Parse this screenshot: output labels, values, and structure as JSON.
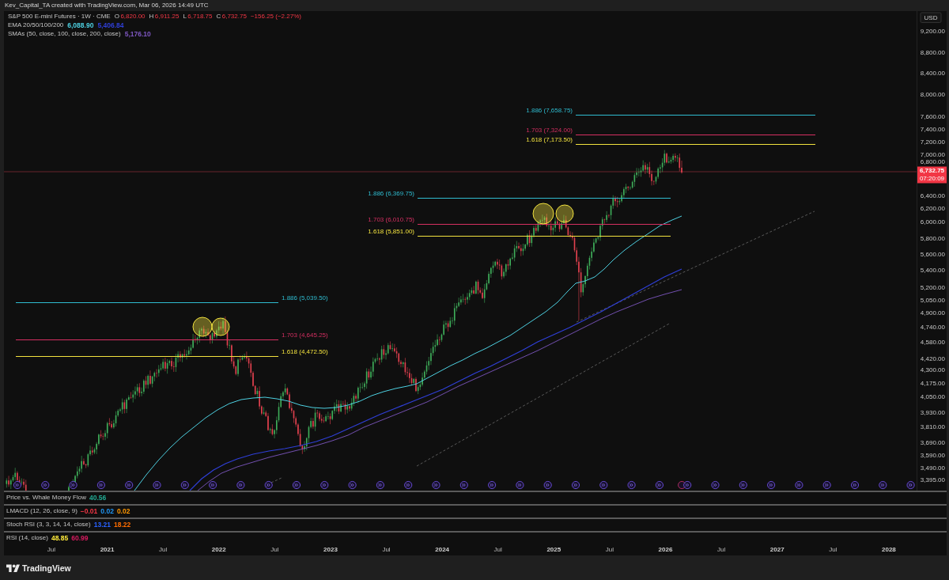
{
  "credit": "Kev_Capital_TA created with TradingView.com, Mar 06, 2026 14:49 UTC",
  "symbol": {
    "name": "S&P 500 E-mini Futures · 1W · CME",
    "down": true,
    "ohlc": [
      {
        "key": "O",
        "value": "6,820.00"
      },
      {
        "key": "H",
        "value": "6,911.25"
      },
      {
        "key": "L",
        "value": "6,718.75"
      },
      {
        "key": "C",
        "value": "6,732.75"
      }
    ],
    "change": "−156.25 (−2.27%)"
  },
  "studies": [
    {
      "name": "EMA 20/50/100/200",
      "values": [
        {
          "text": "6,088.90",
          "color": "#4dd0e1"
        },
        {
          "text": "5,406.84",
          "color": "#2f3fd8"
        }
      ]
    },
    {
      "name": "SMAs (50, close, 100, close, 200, close)",
      "values": [
        {
          "text": "5,176.10",
          "color": "#7e57c2"
        }
      ]
    }
  ],
  "fib_extensions": [
    {
      "levels": [
        {
          "label": "1.886 (5,039.50)",
          "color": "#2fbcd0"
        },
        {
          "label": "1.703 (4,645.25)",
          "color": "#d62f62"
        },
        {
          "label": "1.618 (4,472.50)",
          "color": "#f2e23f"
        }
      ]
    },
    {
      "levels": [
        {
          "label": "1.886 (6,369.75)",
          "color": "#2fbcd0"
        },
        {
          "label": "1.703 (6,010.75)",
          "color": "#d62f62"
        },
        {
          "label": "1.618 (5,851.00)",
          "color": "#f2e23f"
        }
      ]
    },
    {
      "levels": [
        {
          "label": "1.886 (7,658.75)",
          "color": "#2fbcd0"
        },
        {
          "label": "1.703 (7,324.00)",
          "color": "#d62f62"
        },
        {
          "label": "1.618 (7,173.50)",
          "color": "#f2e23f"
        }
      ]
    }
  ],
  "last_price": {
    "price": "6,732.75",
    "countdown": "07:20:09"
  },
  "price_axis": {
    "currency": "USD",
    "labels": [
      "9,200.00",
      "8,800.00",
      "8,400.00",
      "8,000.00",
      "7,600.00",
      "7,400.00",
      "7,200.00",
      "7,000.00",
      "6,800.00",
      "6,400.00",
      "6,200.00",
      "6,000.00",
      "5,800.00",
      "5,600.00",
      "5,400.00",
      "5,200.00",
      "5,050.00",
      "4,900.00",
      "4,740.00",
      "4,580.00",
      "4,420.00",
      "4,300.00",
      "4,175.00",
      "4,050.00",
      "3,930.00",
      "3,810.00",
      "3,690.00",
      "3,590.00",
      "3,490.00",
      "3,395.00"
    ]
  },
  "panes": [
    {
      "name": "Price vs. Whale Money Flow",
      "values": [
        {
          "text": "40.56",
          "color": "#22ab94"
        }
      ]
    },
    {
      "name": "LMACD (12, 26, close, 9)",
      "values": [
        {
          "text": "−0.01",
          "color": "#f23645"
        },
        {
          "text": "0.02",
          "color": "#2196f3"
        },
        {
          "text": "0.02",
          "color": "#ff9800"
        }
      ]
    },
    {
      "name": "Stoch RSI (3, 3, 14, 14, close)",
      "values": [
        {
          "text": "13.21",
          "color": "#2962ff"
        },
        {
          "text": "18.22",
          "color": "#ff6d00"
        }
      ]
    },
    {
      "name": "RSI (14, close)",
      "values": [
        {
          "text": "48.85",
          "color": "#ffeb3b"
        },
        {
          "text": "60.99",
          "color": "#d81b60"
        }
      ]
    }
  ],
  "time_axis": [
    {
      "text": "Jul",
      "kind": "month"
    },
    {
      "text": "2021",
      "kind": "year"
    },
    {
      "text": "Jul",
      "kind": "month"
    },
    {
      "text": "2022",
      "kind": "year"
    },
    {
      "text": "Jul",
      "kind": "month"
    },
    {
      "text": "2023",
      "kind": "year"
    },
    {
      "text": "Jul",
      "kind": "month"
    },
    {
      "text": "2024",
      "kind": "year"
    },
    {
      "text": "Jul",
      "kind": "month"
    },
    {
      "text": "2025",
      "kind": "year"
    },
    {
      "text": "Jul",
      "kind": "month"
    },
    {
      "text": "2026",
      "kind": "year"
    },
    {
      "text": "Jul",
      "kind": "month"
    },
    {
      "text": "2027",
      "kind": "year"
    },
    {
      "text": "Jul",
      "kind": "month"
    },
    {
      "text": "2028",
      "kind": "year"
    }
  ],
  "footer": {
    "brand": "TradingView"
  }
}
